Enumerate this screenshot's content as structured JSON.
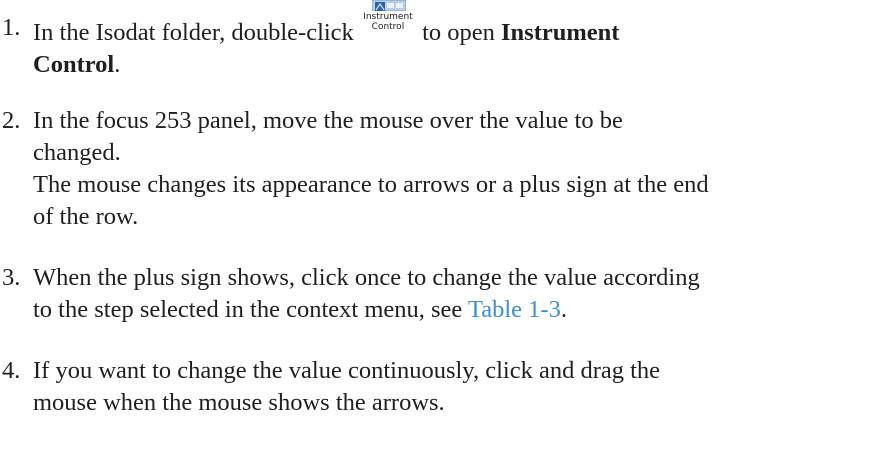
{
  "steps": [
    {
      "number": "1.",
      "text_before_icon": "In the Isodat folder, double-click ",
      "icon": {
        "name": "instrument-control-icon",
        "label_line1": "Instrument",
        "label_line2": "Control"
      },
      "text_after_icon": " to open ",
      "bold_part1": "Instrument",
      "bold_part2": "Control",
      "trailing": "."
    },
    {
      "number": "2.",
      "line1": "In the focus 253 panel, move the mouse over the value to be",
      "line2": "changed.",
      "line3": "The mouse changes its appearance to arrows or a plus sign at the end",
      "line4": "of the row."
    },
    {
      "number": "3.",
      "line1": "When the plus sign shows, click once to change the value according",
      "line2_before_link": "to the step selected in the context menu, see ",
      "link": "Table 1-3",
      "line2_after_link": "."
    },
    {
      "number": "4.",
      "line1": "If you want to change the value continuously, click and drag the",
      "line2": "mouse when the mouse shows the arrows."
    }
  ],
  "colors": {
    "text": "#1f1f1f",
    "link": "#3d8fd1"
  }
}
